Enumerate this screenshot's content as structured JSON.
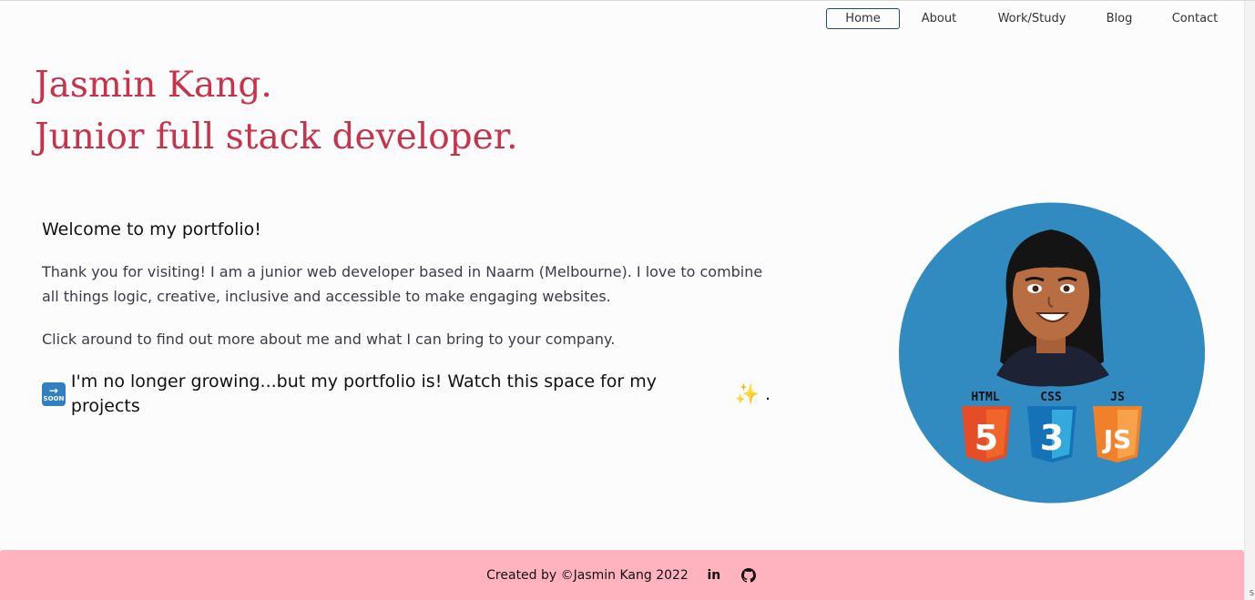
{
  "nav": {
    "home": "Home",
    "about": "About",
    "work": "Work/Study",
    "blog": "Blog",
    "contact": "Contact"
  },
  "hero": {
    "line1": "Jasmin Kang.",
    "line2": "Junior full stack developer."
  },
  "intro": {
    "heading": "Welcome to my portfolio!",
    "para1": "Thank you for visiting! I am a junior web developer based in Naarm (Melbourne). I love to combine all things logic, creative, inclusive and accessible to make engaging websites.",
    "para2": "Click around to find out more about me and what I can bring to your company.",
    "soon_text": "I'm no longer growing...but my portfolio is! Watch this space for my projects",
    "soon_end": ".",
    "soon_badge": "SOON"
  },
  "avatar": {
    "badges": [
      "HTML",
      "CSS",
      "JS"
    ],
    "digits": [
      "5",
      "3",
      "JS"
    ]
  },
  "footer": {
    "credit": "Created by ©Jasmin Kang 2022",
    "linkedin": "in"
  },
  "colors": {
    "accent": "#c8324a",
    "footer_bg": "#ffb3bf",
    "avatar_bg": "#318ac0"
  },
  "scroll_corner": "S"
}
